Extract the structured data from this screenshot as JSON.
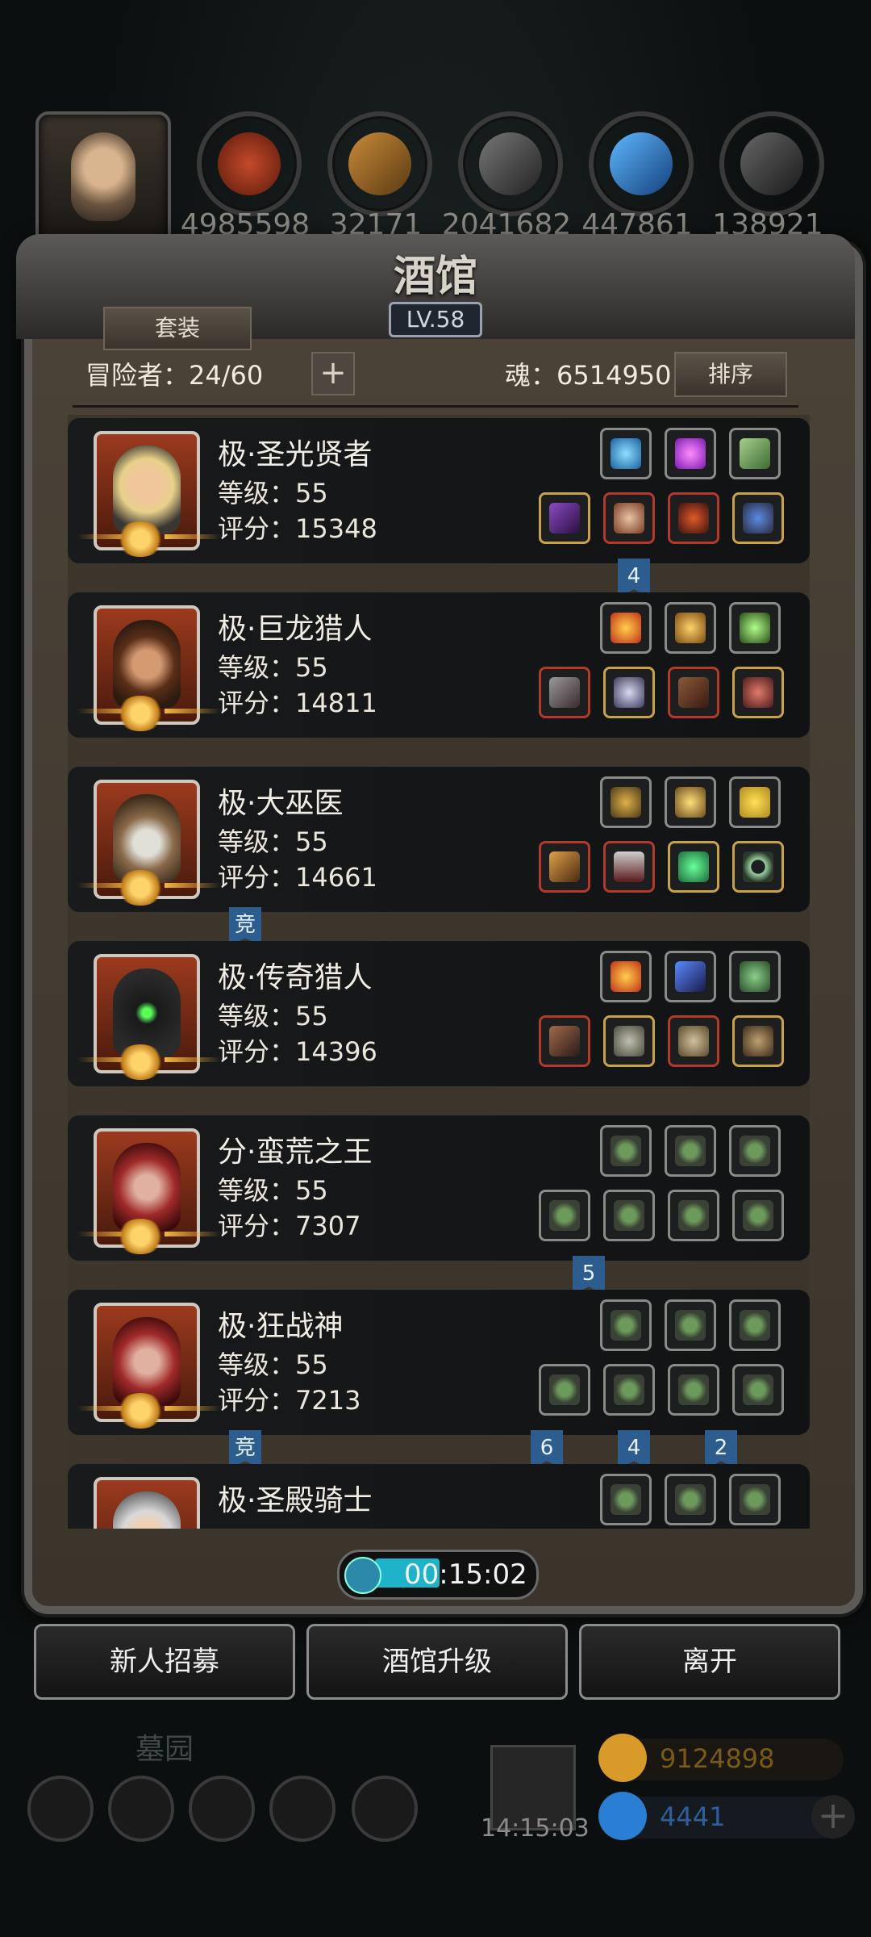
{
  "resources": [
    {
      "name": "meat",
      "value": "4985598",
      "color": "#a2361e"
    },
    {
      "name": "wood",
      "value": "32171",
      "color": "#8a5a22"
    },
    {
      "name": "stone",
      "value": "2041682",
      "color": "#444444"
    },
    {
      "name": "crystal",
      "value": "447861",
      "color": "#2f7fd0"
    },
    {
      "name": "iron",
      "value": "138921",
      "color": "#3c3c3c"
    }
  ],
  "panel": {
    "title": "酒馆",
    "level": "LV.58",
    "set_button": "套装",
    "adventurers_label": "冒险者：24/60",
    "soul_label": "魂：6514950",
    "sort_button": "排序"
  },
  "heroes": [
    {
      "name": "极·圣光贤者",
      "level": "等级：55",
      "score": "评分：15348"
    },
    {
      "name": "极·巨龙猎人",
      "level": "等级：55",
      "score": "评分：14811"
    },
    {
      "name": "极·大巫医",
      "level": "等级：55",
      "score": "评分：14661"
    },
    {
      "name": "极·传奇猎人",
      "level": "等级：55",
      "score": "评分：14396"
    },
    {
      "name": "分·蛮荒之王",
      "level": "等级：55",
      "score": "评分：7307"
    },
    {
      "name": "极·狂战神",
      "level": "等级：55",
      "score": "评分：7213"
    },
    {
      "name": "极·圣殿骑士",
      "level": "",
      "score": ""
    }
  ],
  "tags": {
    "t1": "4",
    "t2": "竞",
    "t3": "5",
    "t4": "竞",
    "t5": "6",
    "t6": "4",
    "t7": "2"
  },
  "timer": "00:15:02",
  "buttons": {
    "recruit": "新人招募",
    "upgrade": "酒馆升级",
    "leave": "离开"
  },
  "hud": {
    "cemetery": "墓园",
    "gift_time": "14:15:03",
    "gold": "9124898",
    "gems": "4441"
  }
}
